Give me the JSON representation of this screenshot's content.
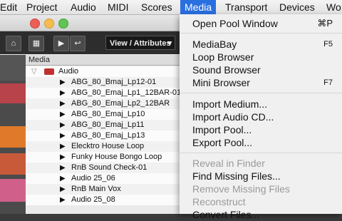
{
  "menubar": {
    "items": [
      "Edit",
      "Project",
      "Audio",
      "MIDI",
      "Scores",
      "Media",
      "Transport",
      "Devices",
      "Wo"
    ]
  },
  "pool": {
    "view_button": "View / Attributes",
    "header": "Media",
    "folder": "Audio",
    "files": [
      "ABG_80_Bmaj_Lp12-01",
      "ABG_80_Emaj_Lp1_12BAR-01",
      "ABG_80_Emaj_Lp2_12BAR",
      "ABG_80_Emaj_Lp10",
      "ABG_80_Emaj_Lp11",
      "ABG_80_Emaj_Lp13",
      "Elecktro House Loop",
      "Funky House Bongo Loop",
      "RnB Sound Check-01",
      "Audio 25_06",
      "RnB Main Vox",
      "Audio 25_08"
    ]
  },
  "media_menu": {
    "open_pool": {
      "label": "Open Pool Window",
      "shortcut": "⌘P"
    },
    "mediabay": {
      "label": "MediaBay",
      "shortcut": "F5"
    },
    "loop_browser": {
      "label": "Loop Browser"
    },
    "sound_browser": {
      "label": "Sound Browser"
    },
    "mini_browser": {
      "label": "Mini Browser",
      "shortcut": "F7"
    },
    "import_medium": {
      "label": "Import Medium..."
    },
    "import_audio_cd": {
      "label": "Import Audio CD..."
    },
    "import_pool": {
      "label": "Import Pool..."
    },
    "export_pool": {
      "label": "Export Pool..."
    },
    "reveal_finder": {
      "label": "Reveal in Finder"
    },
    "find_missing": {
      "label": "Find Missing Files..."
    },
    "remove_missing": {
      "label": "Remove Missing Files"
    },
    "reconstruct": {
      "label": "Reconstruct"
    },
    "convert_files": {
      "label": "Convert Files..."
    }
  },
  "colors": {
    "accent": "#2a6fe0",
    "track_red": "#c94a4a",
    "track_orange": "#e07a2a",
    "track_pink": "#d0608a"
  }
}
